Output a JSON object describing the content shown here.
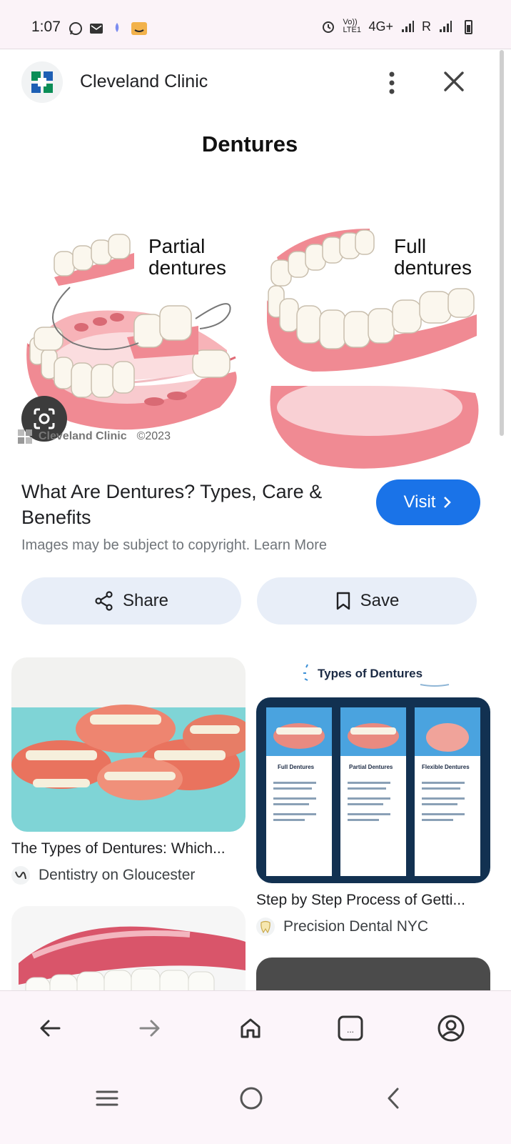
{
  "status_bar": {
    "time": "1:07",
    "network": "4G+",
    "volte": "Vo)) LTE1",
    "roaming": "R"
  },
  "header": {
    "site_name": "Cleveland Clinic",
    "more_icon": "more-vert-icon",
    "close_icon": "close-icon"
  },
  "image": {
    "title": "Dentures",
    "label_partial": "Partial dentures",
    "label_full": "Full dentures",
    "credit_brand": "Cleveland Clinic",
    "credit_year": "©2023"
  },
  "result": {
    "title": "What Are Dentures? Types, Care & Benefits",
    "visit_label": "Visit",
    "copyright_notice": "Images may be subject to copyright. Learn More"
  },
  "actions": {
    "share_label": "Share",
    "save_label": "Save"
  },
  "related": [
    {
      "title": "The Types of Dentures: Which...",
      "source": "Dentistry on Gloucester"
    },
    {
      "title": "Step by Step Process of Getti...",
      "source": "Precision Dental NYC",
      "image_heading": "Types of Dentures",
      "columns": [
        "Full Dentures",
        "Partial Dentures",
        "Flexible Dentures"
      ]
    }
  ],
  "bottom_nav": {
    "back_icon": "arrow-back-icon",
    "forward_icon": "arrow-forward-icon",
    "home_icon": "home-icon",
    "tabs_icon": "tabs-icon",
    "account_icon": "account-icon",
    "tabs_label": "..."
  },
  "colors": {
    "accent": "#1a73e8",
    "chip_bg": "#e8eef8",
    "gum": "#f08a93",
    "tooth": "#fbf7ee"
  }
}
